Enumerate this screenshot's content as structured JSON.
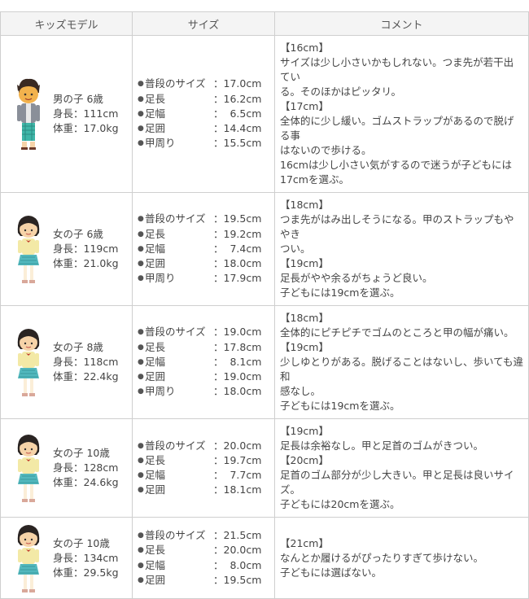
{
  "headers": [
    "キッズモデル",
    "サイズ",
    "コメント"
  ],
  "rows": [
    {
      "kid_type": "boy",
      "model": [
        "男の子 6歳",
        "身長：111cm",
        "体重：17.0kg"
      ],
      "sizes": [
        {
          "label": "普段のサイズ",
          "value": "：17.0cm"
        },
        {
          "label": "足長",
          "value": "：16.2cm"
        },
        {
          "label": "足幅",
          "value": "：  6.5cm"
        },
        {
          "label": "足囲",
          "value": "：14.4cm"
        },
        {
          "label": "甲周り",
          "value": "：15.5cm"
        }
      ],
      "comment": [
        "【16cm】",
        "サイズは少し小さいかもしれない。つま先が若干出てい",
        "る。そのほかはピッタリ。",
        "【17cm】",
        "全体的に少し緩い。ゴムストラップがあるので脱げる事",
        "はないので歩ける。",
        "16cmは少し小さい気がするので迷うが子どもには",
        "17cmを選ぶ。"
      ]
    },
    {
      "kid_type": "girl",
      "model": [
        "女の子 6歳",
        "身長：119cm",
        "体重：21.0kg"
      ],
      "sizes": [
        {
          "label": "普段のサイズ",
          "value": "：19.5cm"
        },
        {
          "label": "足長",
          "value": "：19.2cm"
        },
        {
          "label": "足幅",
          "value": "：  7.4cm"
        },
        {
          "label": "足囲",
          "value": "：18.0cm"
        },
        {
          "label": "甲周り",
          "value": "：17.9cm"
        }
      ],
      "comment": [
        "【18cm】",
        "つま先がはみ出しそうになる。甲のストラップもややき",
        "つい。",
        "【19cm】",
        "足長がやや余るがちょうど良い。",
        "子どもには19cmを選ぶ。"
      ]
    },
    {
      "kid_type": "girl",
      "model": [
        "女の子 8歳",
        "身長：118cm",
        "体重：22.4kg"
      ],
      "sizes": [
        {
          "label": "普段のサイズ",
          "value": "：19.0cm"
        },
        {
          "label": "足長",
          "value": "：17.8cm"
        },
        {
          "label": "足幅",
          "value": "：  8.1cm"
        },
        {
          "label": "足囲",
          "value": "：19.0cm"
        },
        {
          "label": "甲周り",
          "value": "：18.0cm"
        }
      ],
      "comment": [
        "【18cm】",
        "全体的にピチピチでゴムのところと甲の幅が痛い。",
        "【19cm】",
        "少しゆとりがある。脱げることはないし、歩いても違和",
        "感なし。",
        "子どもには19cmを選ぶ。"
      ]
    },
    {
      "kid_type": "girl",
      "model": [
        "女の子 10歳",
        "身長：128cm",
        "体重：24.6kg"
      ],
      "sizes": [
        {
          "label": "普段のサイズ",
          "value": "：20.0cm"
        },
        {
          "label": "足長",
          "value": "：19.7cm"
        },
        {
          "label": "足幅",
          "value": "：  7.7cm"
        },
        {
          "label": "足囲",
          "value": "：18.1cm"
        }
      ],
      "comment": [
        "【19cm】",
        "足長は余裕なし。甲と足首のゴムがきつい。",
        "【20cm】",
        "足首のゴム部分が少し大きい。甲と足長は良いサイズ。",
        "子どもには20cmを選ぶ。"
      ]
    },
    {
      "kid_type": "girl",
      "model": [
        "女の子 10歳",
        "身長：134cm",
        "体重：29.5kg"
      ],
      "sizes": [
        {
          "label": "普段のサイズ",
          "value": "：21.5cm"
        },
        {
          "label": "足長",
          "value": "：20.0cm"
        },
        {
          "label": "足幅",
          "value": "：  8.0cm"
        },
        {
          "label": "足囲",
          "value": "：19.5cm"
        }
      ],
      "comment": [
        "【21cm】",
        "なんとか履けるがぴったりすぎて歩けない。",
        "子どもには選ばない。"
      ]
    }
  ]
}
